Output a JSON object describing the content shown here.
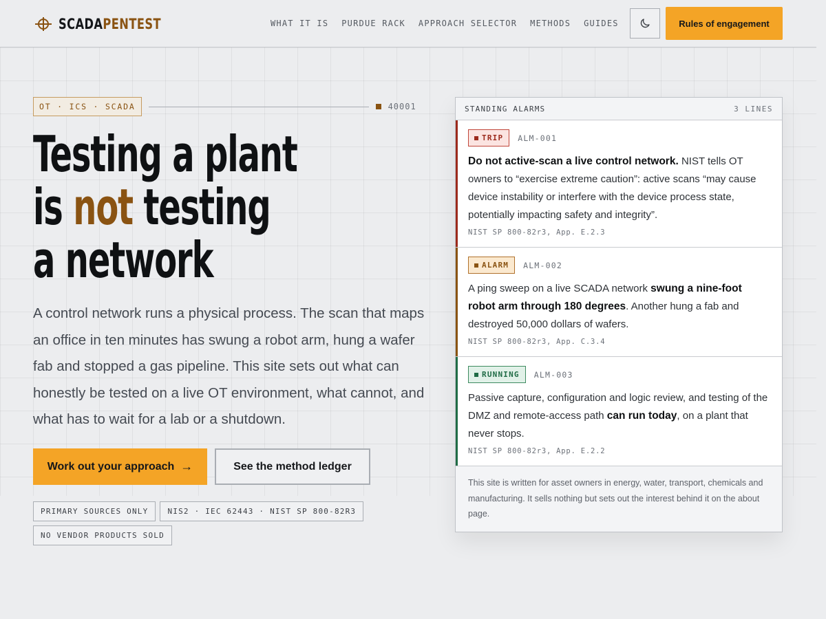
{
  "brand": {
    "name_a": "SCADA",
    "name_b": "PENTEST"
  },
  "nav": {
    "items": [
      {
        "label": "WHAT IT IS"
      },
      {
        "label": "PURDUE RACK"
      },
      {
        "label": "APPROACH SELECTOR"
      },
      {
        "label": "METHODS"
      },
      {
        "label": "GUIDES"
      }
    ],
    "cta_label": "Rules of engagement"
  },
  "hero": {
    "eyebrow_tag": "OT · ICS · SCADA",
    "eyebrow_code": "40001",
    "title_line1": "Testing a plant",
    "title_line2_pre": "is ",
    "title_line2_accent": "not",
    "title_line2_post": " testing",
    "title_line3": "a network",
    "lede": "A control network runs a physical process. The scan that maps an office in ten minutes has swung a robot arm, hung a wafer fab and stopped a gas pipeline. This site sets out what can honestly be tested on a live OT environment, what cannot, and what has to wait for a lab or a shutdown.",
    "primary_cta": "Work out your approach",
    "primary_cta_arrow": "→",
    "secondary_cta": "See the method ledger",
    "chips": [
      {
        "label": "PRIMARY SOURCES ONLY"
      },
      {
        "label": "NIS2 · IEC 62443 · NIST SP 800-82R3"
      },
      {
        "label": "NO VENDOR PRODUCTS SOLD"
      }
    ]
  },
  "alarms": {
    "title": "STANDING ALARMS",
    "count": "3 LINES",
    "items": [
      {
        "badge": "TRIP",
        "id": "ALM-001",
        "bold_lead": "Do not active-scan a live control network.",
        "text_after": " NIST tells OT owners to “exercise extreme caution”: active scans “may cause device instability or interfere with the device process state, potentially impacting safety and integrity”.",
        "ref": "NIST SP 800-82r3, App. E.2.3",
        "color": "#9c2a1c",
        "badge_bg": "#fbe4e1",
        "badge_border": "#c0463a"
      },
      {
        "badge": "ALARM",
        "id": "ALM-002",
        "text_before": "A ping sweep on a live SCADA network ",
        "bold_mid": "swung a nine-foot robot arm through 180 degrees",
        "text_after": ". Another hung a fab and destroyed 50,000 dollars of wafers.",
        "ref": "NIST SP 800-82r3, App. C.3.4",
        "color": "#8a5312",
        "badge_bg": "#fbe9cf",
        "badge_border": "#b0702a"
      },
      {
        "badge": "RUNNING",
        "id": "ALM-003",
        "text_before": "Passive capture, configuration and logic review, and testing of the DMZ and remote-access path ",
        "bold_mid": "can run today",
        "text_after": ", on a plant that never stops.",
        "ref": "NIST SP 800-82r3, App. E.2.2",
        "color": "#1f6b45",
        "badge_bg": "#e1f1e8",
        "badge_border": "#3d8a5f"
      }
    ],
    "footer": "This site is written for asset owners in energy, water, transport, chemicals and manufacturing. It sells nothing but sets out the interest behind it on the about page."
  },
  "colors": {
    "accent": "#f4a426",
    "brand_brown": "#8a5312",
    "page_bg": "#ecedef"
  },
  "icons": {
    "logo": "crosshair-icon",
    "theme": "moon-icon",
    "cta_arrow": "arrow-right-icon"
  }
}
